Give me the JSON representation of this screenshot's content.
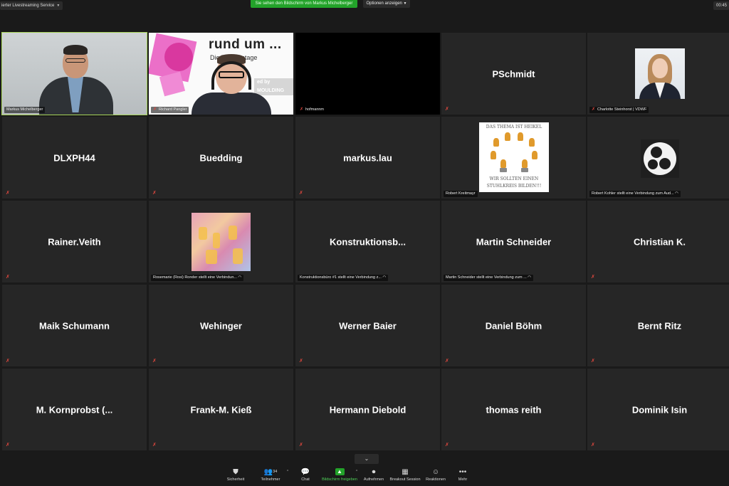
{
  "topbar": {
    "service_label": "ierter Livestreaming Service",
    "share_banner": "Sie sehen den Bildschirm von Markus Michelberger",
    "options_label": "Optionen anzeigen",
    "timer": "00:45"
  },
  "tiles": {
    "r1c1": {
      "label": "Markus Michelberger"
    },
    "r1c2": {
      "label": "Richard Pangler",
      "brand": "rund um ...",
      "brand_sub": "Die     Thementage",
      "badge": "ed by\nMOULDING"
    },
    "r1c3": {
      "label": "hofmannm"
    },
    "r1c4": {
      "name": "PSchmidt"
    },
    "r1c5": {
      "label": "Charlotte Steinhorst | VDWF"
    },
    "r2c1": {
      "name": "DLXPH44"
    },
    "r2c2": {
      "name": "Buedding"
    },
    "r2c3": {
      "name": "markus.lau"
    },
    "r2c4": {
      "label": "Robert Kreitmayr",
      "img_top": "DAS THEMA IST HEIKEL",
      "img_bottom1": "WIR SOLLTEN EINEN",
      "img_bottom2": "STUHLKREIS BILDEN!!!"
    },
    "r2c5": {
      "label": "Robert Kohler stellt eine Verbindung zum Aud..."
    },
    "r3c1": {
      "name": "Rainer.Veith"
    },
    "r3c2": {
      "label": "Rosemarie (Rosi) Ronder stellt eine Verbindun..."
    },
    "r3c3": {
      "name": "Konstruktionsb...",
      "label": "Konstruktionsbüro #1 stellt eine Verbindung z..."
    },
    "r3c4": {
      "name": "Martin Schneider",
      "label": "Martin Schneider stellt eine Verbindung zum ..."
    },
    "r3c5": {
      "name": "Christian K."
    },
    "r4c1": {
      "name": "Maik Schumann"
    },
    "r4c2": {
      "name": "Wehinger"
    },
    "r4c3": {
      "name": "Werner Baier"
    },
    "r4c4": {
      "name": "Daniel Böhm"
    },
    "r4c5": {
      "name": "Bernt Ritz"
    },
    "r5c1": {
      "name": "M. Kornprobst (..."
    },
    "r5c2": {
      "name": "Frank-M. Kieß"
    },
    "r5c3": {
      "name": "Hermann Diebold"
    },
    "r5c4": {
      "name": "thomas reith"
    },
    "r5c5": {
      "name": "Dominik Isin"
    }
  },
  "toolbar": {
    "security": "Sicherheit",
    "participants": "Teilnehmer",
    "participants_count": "34",
    "chat": "Chat",
    "share": "Bildschirm freigeben",
    "record": "Aufnehmen",
    "breakout": "Breakout Session",
    "reactions": "Reaktionen",
    "more": "Mehr"
  },
  "colors": {
    "share_green": "#23a32a",
    "speaker_outline": "#a8d65a",
    "mute_red": "#e0483e"
  }
}
